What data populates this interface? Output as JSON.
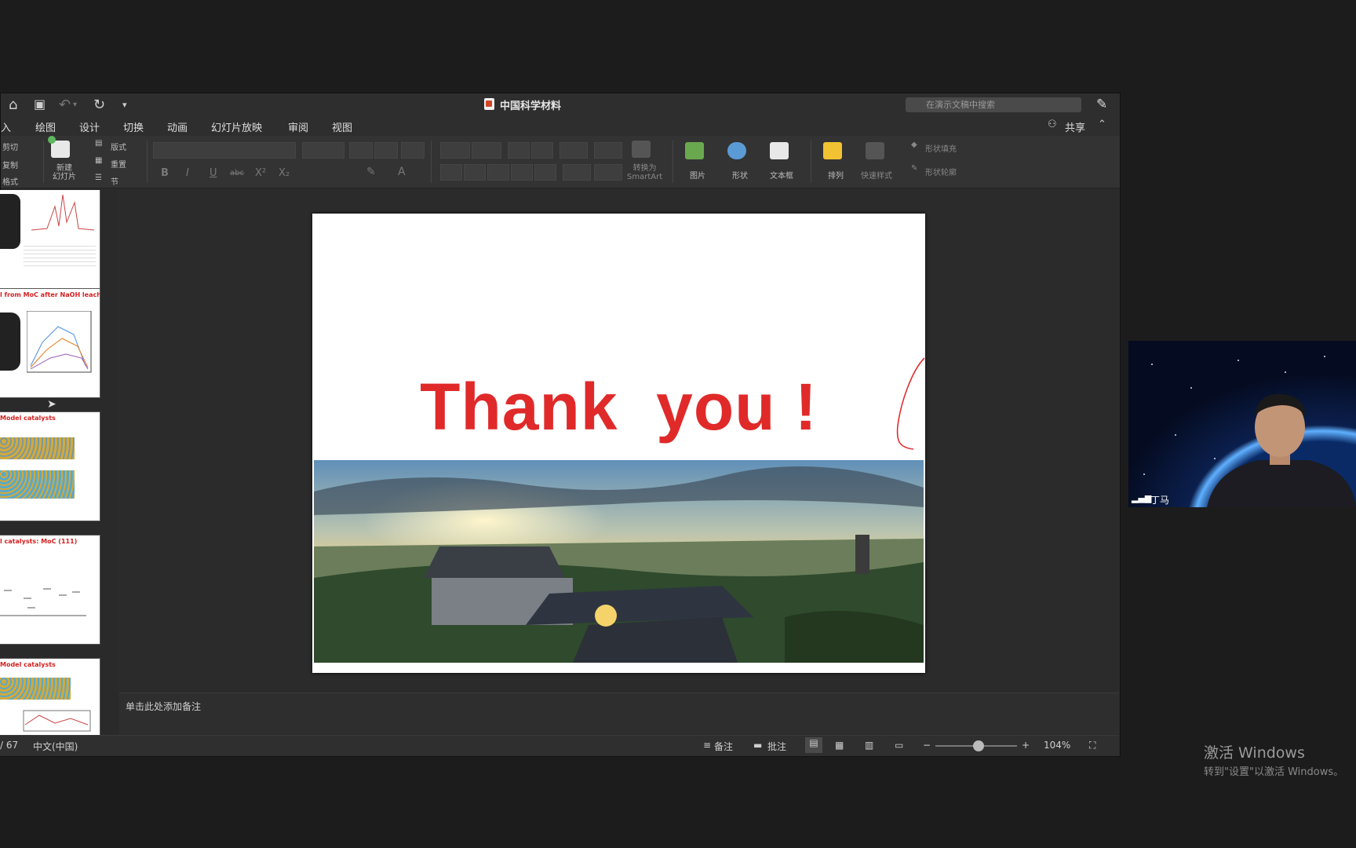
{
  "app": {
    "doc_title": "中国科学材料",
    "search_placeholder": "在演示文稿中搜索",
    "share_label": "共享"
  },
  "tabs": [
    "入",
    "绘图",
    "设计",
    "切换",
    "动画",
    "幻灯片放映",
    "审阅",
    "视图"
  ],
  "ribbon": {
    "clipboard": [
      "剪切",
      "复制",
      "格式"
    ],
    "new_slide": "新建\n幻灯片",
    "layout": "版式",
    "reset": "重置",
    "section": "节",
    "convert_smartart": "转换为\nSmartArt",
    "picture": "图片",
    "shape": "形状",
    "textbox": "文本框",
    "arrange": "排列",
    "quick_styles": "快速样式",
    "shape_fill": "形状填充",
    "shape_outline": "形状轮廓"
  },
  "thumbnails": [
    {
      "title": ""
    },
    {
      "title": "l from MoC after NaOH leaching"
    },
    {
      "title": "Model catalysts"
    },
    {
      "title": "l catalysts: MoC (111)"
    },
    {
      "title": "Model catalysts"
    }
  ],
  "slide": {
    "text": "Thank  you !",
    "text_color": "#e02a2a"
  },
  "notes_placeholder": "单击此处添加备注",
  "status": {
    "slide_count": "/ 67",
    "language": "中文(中国)",
    "notes_label": "备注",
    "comments_label": "批注",
    "zoom": "104%",
    "zoom_level_percent": 53
  },
  "webcam": {
    "name": "丁马"
  },
  "watermark": {
    "line1": "激活 Windows",
    "line2": "转到\"设置\"以激活 Windows。"
  },
  "colors": {
    "accent_red": "#d24726",
    "window_bg": "#2b2b2b"
  }
}
